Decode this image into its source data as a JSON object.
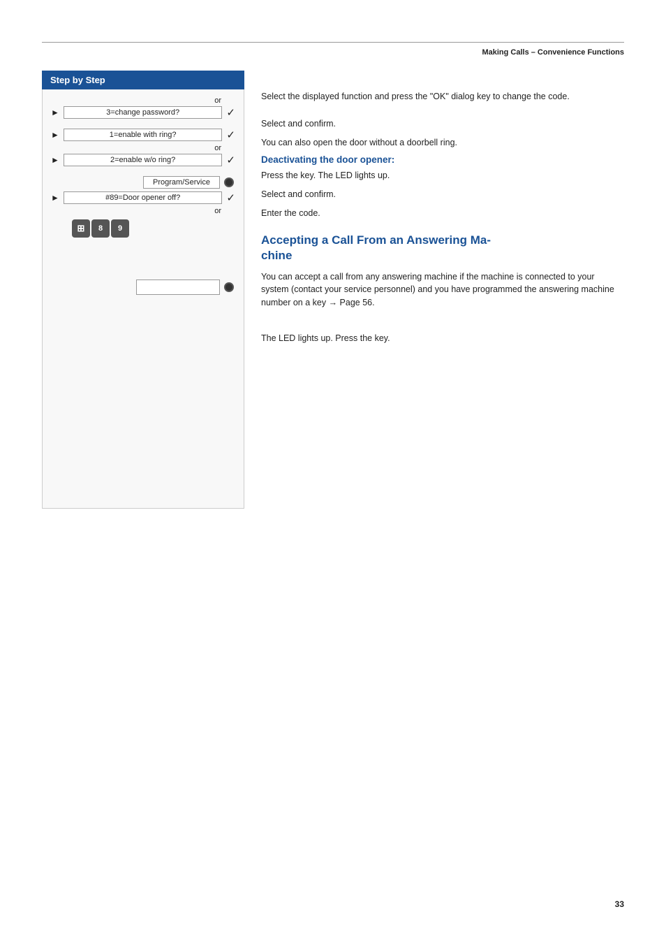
{
  "header": {
    "title": "Making Calls – Convenience Functions"
  },
  "stepbystep": {
    "label": "Step by Step"
  },
  "steps": [
    {
      "id": "step1",
      "or_above": true,
      "arrow": true,
      "button_label": "3=change password?",
      "check": true
    },
    {
      "id": "step2",
      "arrow": true,
      "button_label": "1=enable with ring?",
      "check": true
    },
    {
      "id": "step2b",
      "or_above": true,
      "arrow": true,
      "button_label": "2=enable w/o ring?",
      "check": true
    },
    {
      "id": "step3",
      "program_service": true,
      "led": true
    },
    {
      "id": "step4",
      "arrow": true,
      "button_label": "#89=Door opener off?",
      "check": true,
      "or_below": true
    },
    {
      "id": "step5",
      "key_icons": [
        "#",
        "8",
        "9"
      ]
    }
  ],
  "descriptions": [
    {
      "id": "desc1",
      "text": "Select the displayed function and press the \"OK\" dialog key to change the code."
    },
    {
      "id": "desc2",
      "text": "Select and confirm."
    },
    {
      "id": "desc3",
      "text": "You can also open the door without a doorbell ring."
    },
    {
      "id": "desc4_title",
      "text": "Deactivating the door opener:",
      "is_title": true
    },
    {
      "id": "desc4",
      "text": "Press the key. The LED lights up."
    },
    {
      "id": "desc5",
      "text": "Select and confirm."
    },
    {
      "id": "desc6",
      "text": "Enter the code."
    }
  ],
  "accepting_section": {
    "title_line1": "Accepting a Call From an Answering Ma-",
    "title_line2": "chine",
    "body": "You can accept a call from any answering machine if the machine is connected to your system (contact your service personnel) and you have programmed the answering machine number on a key → Page 56.",
    "led_desc": "The LED lights up. Press the key.",
    "page_ref": "56"
  },
  "page_number": "33"
}
